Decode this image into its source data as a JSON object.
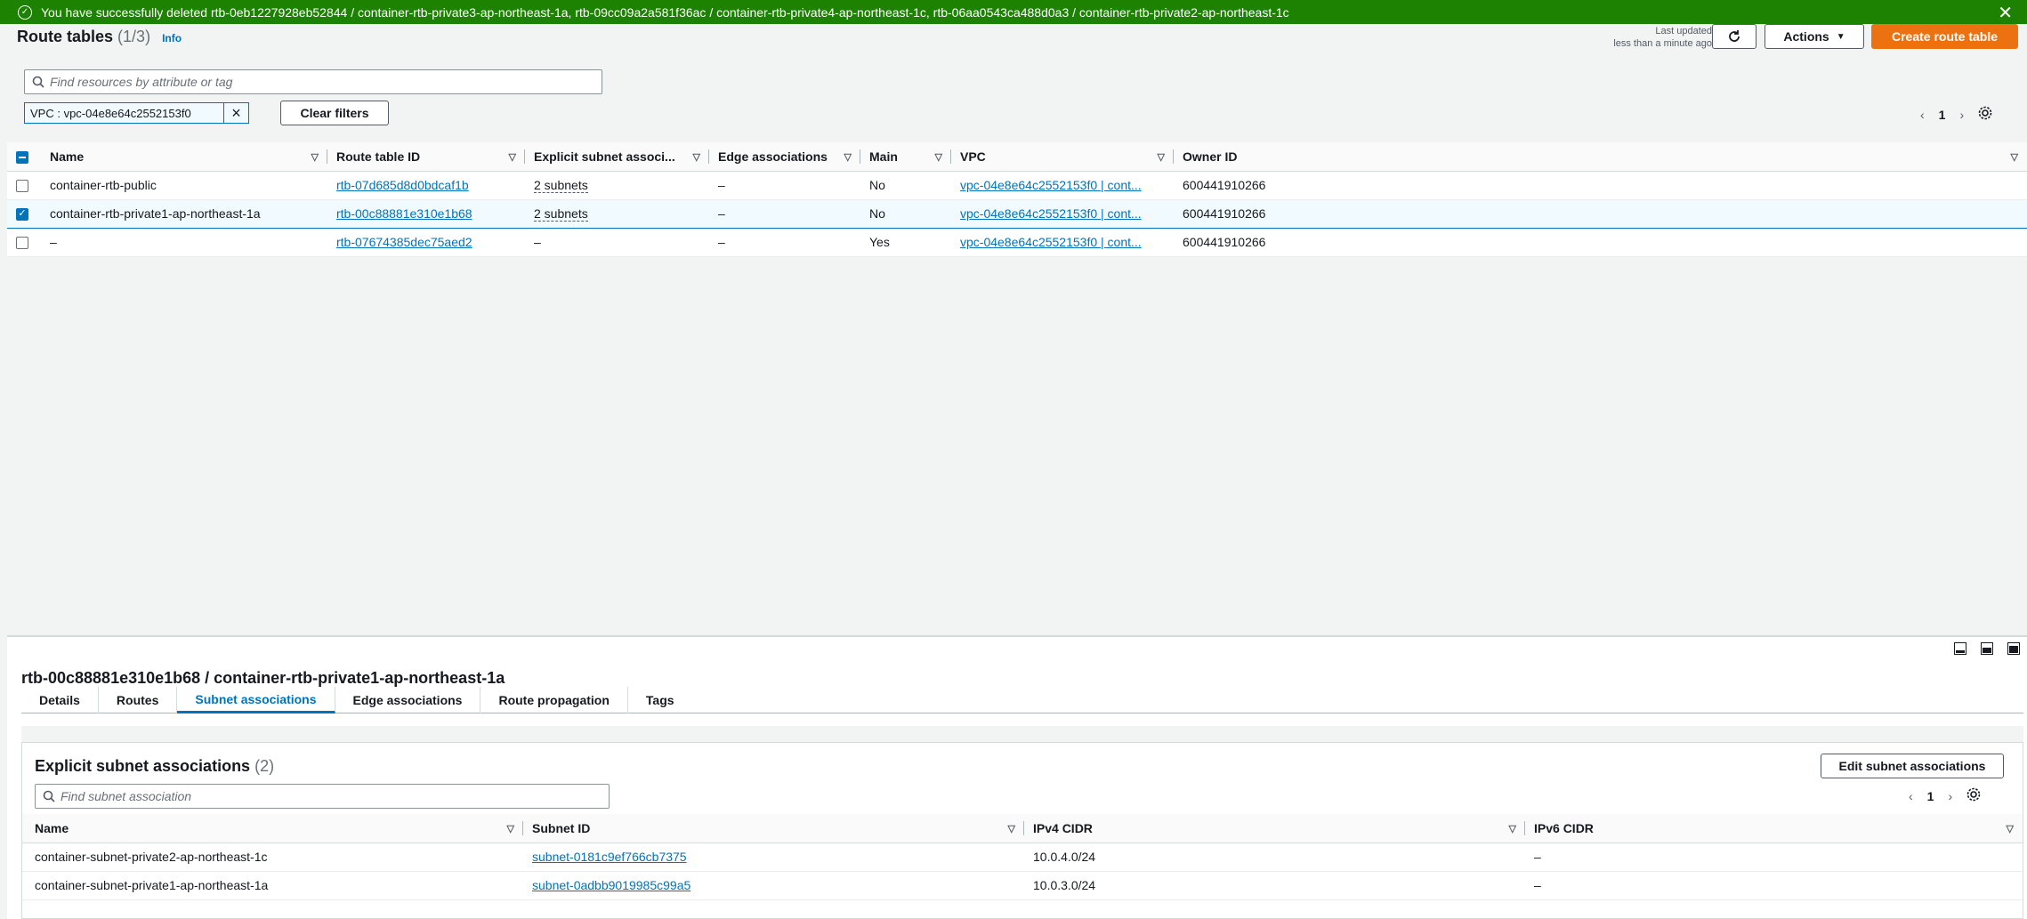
{
  "flash": {
    "message": "You have successfully deleted rtb-0eb1227928eb52844 / container-rtb-private3-ap-northeast-1a, rtb-09cc09a2a581f36ac / container-rtb-private4-ap-northeast-1c, rtb-06aa0543ca488d0a3 / container-rtb-private2-ap-northeast-1c",
    "color": "#1d8102"
  },
  "header": {
    "title": "Route tables",
    "count": "(1/3)",
    "info": "Info",
    "last_updated_label": "Last updated",
    "last_updated_value": "less than a minute ago",
    "actions_label": "Actions",
    "create_label": "Create route table",
    "accent": "#ec7211"
  },
  "filter": {
    "placeholder": "Find resources by attribute or tag",
    "token": "VPC : vpc-04e8e64c2552153f0",
    "clear_label": "Clear filters"
  },
  "pager": {
    "page": "1"
  },
  "table": {
    "columns": [
      "Name",
      "Route table ID",
      "Explicit subnet associ...",
      "Edge associations",
      "Main",
      "VPC",
      "Owner ID"
    ],
    "rows": [
      {
        "checked": false,
        "name": "container-rtb-public",
        "id": "rtb-07d685d8d0bdcaf1b",
        "subnets": "2 subnets",
        "edge": "–",
        "main": "No",
        "vpc": "vpc-04e8e64c2552153f0 | cont...",
        "owner": "600441910266"
      },
      {
        "checked": true,
        "name": "container-rtb-private1-ap-northeast-1a",
        "id": "rtb-00c88881e310e1b68",
        "subnets": "2 subnets",
        "edge": "–",
        "main": "No",
        "vpc": "vpc-04e8e64c2552153f0 | cont...",
        "owner": "600441910266"
      },
      {
        "checked": false,
        "name": "–",
        "id": "rtb-07674385dec75aed2",
        "subnets": "–",
        "edge": "–",
        "main": "Yes",
        "vpc": "vpc-04e8e64c2552153f0 | cont...",
        "owner": "600441910266"
      }
    ]
  },
  "detail": {
    "title": "rtb-00c88881e310e1b68 / container-rtb-private1-ap-northeast-1a",
    "tabs": [
      "Details",
      "Routes",
      "Subnet associations",
      "Edge associations",
      "Route propagation",
      "Tags"
    ],
    "active_tab": "Subnet associations",
    "section_title": "Explicit subnet associations",
    "section_count": "(2)",
    "edit_label": "Edit subnet associations",
    "search_placeholder": "Find subnet association",
    "page": "1",
    "columns": [
      "Name",
      "Subnet ID",
      "IPv4 CIDR",
      "IPv6 CIDR"
    ],
    "rows": [
      {
        "name": "container-subnet-private2-ap-northeast-1c",
        "subnet": "subnet-0181c9ef766cb7375",
        "ipv4": "10.0.4.0/24",
        "ipv6": "–"
      },
      {
        "name": "container-subnet-private1-ap-northeast-1a",
        "subnet": "subnet-0adbb9019985c99a5",
        "ipv4": "10.0.3.0/24",
        "ipv6": "–"
      }
    ]
  }
}
